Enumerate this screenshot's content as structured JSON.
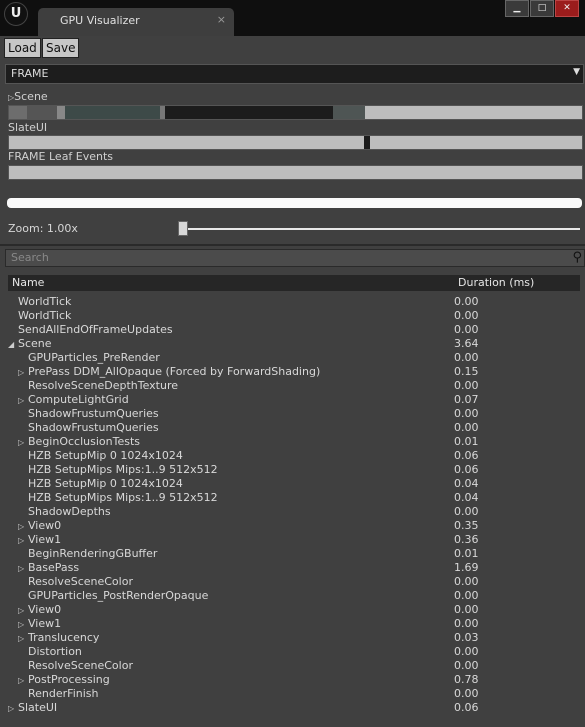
{
  "title_bar": {
    "logo": "U",
    "tab_title": "GPU Visualizer",
    "tab_close": "×",
    "minimize": "▁",
    "maximize": "□",
    "close": "✕"
  },
  "toolbar": {
    "load_label": "Load",
    "save_label": "Save"
  },
  "frame_select": {
    "value": "FRAME",
    "arrow": "▼"
  },
  "sections": {
    "scene_label": "Scene",
    "scene_arrow": "▷",
    "slateui_label": "SlateUI",
    "leaf_label": "FRAME Leaf Events"
  },
  "zoom": {
    "label": "Zoom: 1.00x",
    "value": 1.0
  },
  "search": {
    "placeholder": "Search",
    "icon": "search-icon"
  },
  "table": {
    "columns": [
      "Name",
      "Duration (ms)"
    ],
    "rows": [
      {
        "indent": 0,
        "expander": "",
        "name": "WorldTick",
        "duration": "0.00"
      },
      {
        "indent": 0,
        "expander": "",
        "name": "WorldTick",
        "duration": "0.00"
      },
      {
        "indent": 0,
        "expander": "",
        "name": "SendAllEndOfFrameUpdates",
        "duration": "0.00"
      },
      {
        "indent": 0,
        "expander": "◢",
        "name": "Scene",
        "duration": "3.64"
      },
      {
        "indent": 1,
        "expander": "",
        "name": "GPUParticles_PreRender",
        "duration": "0.00"
      },
      {
        "indent": 1,
        "expander": "▷",
        "name": "PrePass DDM_AllOpaque (Forced by ForwardShading)",
        "duration": "0.15"
      },
      {
        "indent": 1,
        "expander": "",
        "name": "ResolveSceneDepthTexture",
        "duration": "0.00"
      },
      {
        "indent": 1,
        "expander": "▷",
        "name": "ComputeLightGrid",
        "duration": "0.07"
      },
      {
        "indent": 1,
        "expander": "",
        "name": "ShadowFrustumQueries",
        "duration": "0.00"
      },
      {
        "indent": 1,
        "expander": "",
        "name": "ShadowFrustumQueries",
        "duration": "0.00"
      },
      {
        "indent": 1,
        "expander": "▷",
        "name": "BeginOcclusionTests",
        "duration": "0.01"
      },
      {
        "indent": 1,
        "expander": "",
        "name": "HZB SetupMip 0 1024x1024",
        "duration": "0.06"
      },
      {
        "indent": 1,
        "expander": "",
        "name": "HZB SetupMips Mips:1..9 512x512",
        "duration": "0.06"
      },
      {
        "indent": 1,
        "expander": "",
        "name": "HZB SetupMip 0 1024x1024",
        "duration": "0.04"
      },
      {
        "indent": 1,
        "expander": "",
        "name": "HZB SetupMips Mips:1..9 512x512",
        "duration": "0.04"
      },
      {
        "indent": 1,
        "expander": "",
        "name": "ShadowDepths",
        "duration": "0.00"
      },
      {
        "indent": 1,
        "expander": "▷",
        "name": "View0",
        "duration": "0.35"
      },
      {
        "indent": 1,
        "expander": "▷",
        "name": "View1",
        "duration": "0.36"
      },
      {
        "indent": 1,
        "expander": "",
        "name": "BeginRenderingGBuffer",
        "duration": "0.01"
      },
      {
        "indent": 1,
        "expander": "▷",
        "name": "BasePass",
        "duration": "1.69"
      },
      {
        "indent": 1,
        "expander": "",
        "name": "ResolveSceneColor",
        "duration": "0.00"
      },
      {
        "indent": 1,
        "expander": "",
        "name": "GPUParticles_PostRenderOpaque",
        "duration": "0.00"
      },
      {
        "indent": 1,
        "expander": "▷",
        "name": "View0",
        "duration": "0.00"
      },
      {
        "indent": 1,
        "expander": "▷",
        "name": "View1",
        "duration": "0.00"
      },
      {
        "indent": 1,
        "expander": "▷",
        "name": "Translucency",
        "duration": "0.03"
      },
      {
        "indent": 1,
        "expander": "",
        "name": "Distortion",
        "duration": "0.00"
      },
      {
        "indent": 1,
        "expander": "",
        "name": "ResolveSceneColor",
        "duration": "0.00"
      },
      {
        "indent": 1,
        "expander": "▷",
        "name": "PostProcessing",
        "duration": "0.78"
      },
      {
        "indent": 1,
        "expander": "",
        "name": "RenderFinish",
        "duration": "0.00"
      },
      {
        "indent": 0,
        "expander": "▷",
        "name": "SlateUI",
        "duration": "0.06"
      }
    ]
  },
  "colors": {
    "window_bg": "#404040",
    "bar_bg": "#bdbdbd",
    "bar_dark": "#1c1c1c",
    "bar_teal": "#3d4a48"
  }
}
